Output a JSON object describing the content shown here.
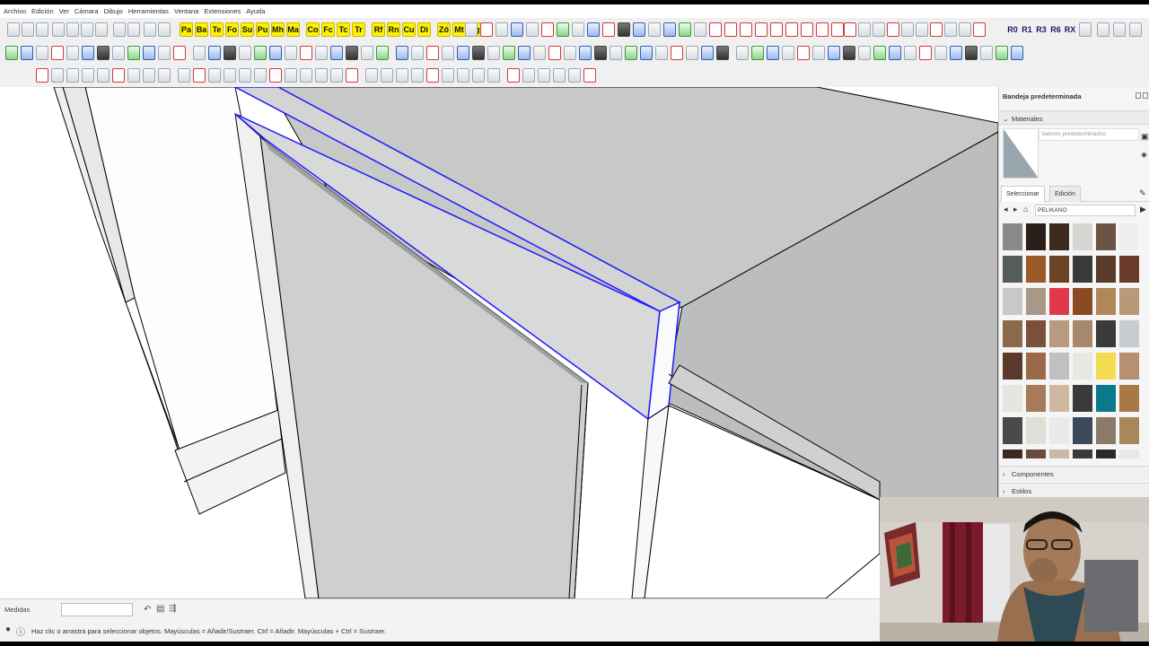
{
  "menu": {
    "items": [
      "Archivo",
      "Edición",
      "Ver",
      "Cámara",
      "Dibujo",
      "Herramientas",
      "Ventana",
      "Extensiones",
      "Ayuda"
    ]
  },
  "toolbar": {
    "yellow_buttons": [
      "Pa",
      "Ba",
      "Te",
      "Fo",
      "Su",
      "Pu",
      "Mh",
      "Ma",
      "Co",
      "Fc",
      "Tc",
      "Tr",
      "Rf",
      "Rn",
      "Cu",
      "Di",
      "Zó",
      "Mt",
      "Cg"
    ],
    "rotate_buttons": [
      "R0",
      "R1",
      "R3",
      "R6",
      "RX"
    ]
  },
  "measure": {
    "label": "Medidas",
    "value": ""
  },
  "status": {
    "text": "Haz clic o arrastra para seleccionar objetos. Mayúsculas = Añadir/Sustraer. Ctrl = Añadir. Mayúsculas + Ctrl = Sustraer."
  },
  "tray": {
    "title": "Bandeja predeterminada",
    "materials_header": "Materiales",
    "material_name_placeholder": "Valores predeterminados",
    "tab_select": "Seleccionar",
    "tab_edit": "Edición",
    "library": "PELIKANO",
    "components_header": "Componentes",
    "styles_header": "Estilos",
    "swatch_colors": [
      "#8a8a8a",
      "#2a1f18",
      "#3c2a1e",
      "#d8d6d2",
      "#6b5443",
      "#efefef",
      "#555d58",
      "#9a5a2a",
      "#6a4424",
      "#3a3a3a",
      "#5a3a28",
      "#6a3a28",
      "#c8c8c8",
      "#a89888",
      "#e03a4a",
      "#8a4a22",
      "#b08858",
      "#b89a78",
      "#8a6a4a",
      "#7a5038",
      "#b89a80",
      "#a8886a",
      "#3a3a3a",
      "#c8ccd0",
      "#5a3a2a",
      "#9a6a48",
      "#c0c0c0",
      "#e8e8e2",
      "#f4dc50",
      "#b89070",
      "#e6e6e0",
      "#a87a5a",
      "#d0b8a0",
      "#3a3a3a",
      "#0a7a8a",
      "#a87848",
      "#4a4a4a",
      "#e0e0d8",
      "#eaeaea",
      "#3a4a5a",
      "#8a7a6a",
      "#a88858",
      "#3a2a22",
      "#6a4a3a",
      "#c8b8a8",
      "#3a3a3a",
      "#2a2a2a",
      "#e8e8e8"
    ]
  },
  "accent_colors": {
    "selection": "#1a1aff",
    "tray_bg": "#f5f5f5"
  }
}
